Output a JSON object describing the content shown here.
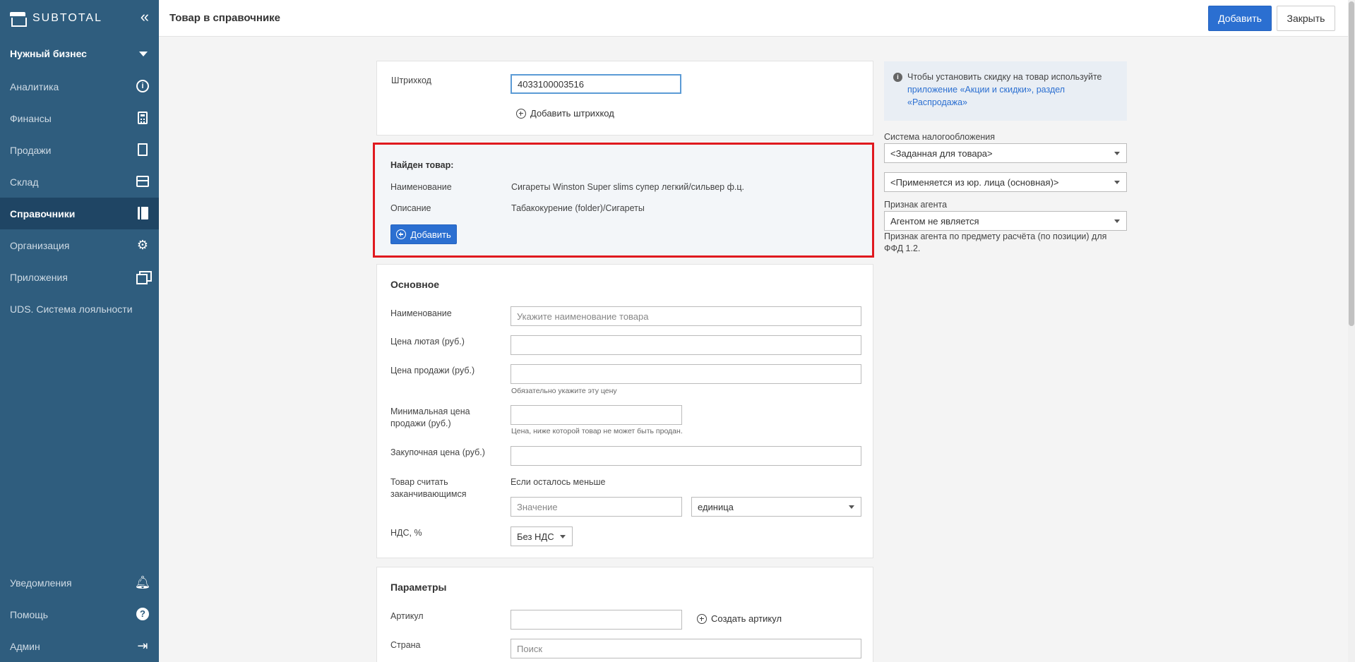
{
  "sidebar": {
    "logo": "SUBTOTAL",
    "business": "Нужный бизнес",
    "items": [
      {
        "label": "Аналитика",
        "icon": "info-icon"
      },
      {
        "label": "Финансы",
        "icon": "calculator-icon"
      },
      {
        "label": "Продажи",
        "icon": "document-icon"
      },
      {
        "label": "Склад",
        "icon": "box-icon"
      },
      {
        "label": "Справочники",
        "icon": "book-icon",
        "active": true
      },
      {
        "label": "Организация",
        "icon": "gear-icon"
      },
      {
        "label": "Приложения",
        "icon": "windows-icon"
      },
      {
        "label": "UDS. Система лояльности"
      }
    ],
    "bottom": [
      {
        "label": "Уведомления",
        "icon": "bell-icon"
      },
      {
        "label": "Помощь",
        "icon": "help-icon"
      },
      {
        "label": "Админ",
        "icon": "logout-icon"
      }
    ]
  },
  "header": {
    "title": "Товар в справочнике",
    "add_label": "Добавить",
    "close_label": "Закрыть"
  },
  "barcode": {
    "label": "Штрихкод",
    "value": "4033100003516",
    "add_label": "Добавить штрихкод"
  },
  "found": {
    "title": "Найден товар:",
    "name_label": "Наименование",
    "name_value": "Сигареты Winston Super slims супер легкий/сильвер ф.ц.",
    "desc_label": "Описание",
    "desc_value": "Табакокурение (folder)/Сигареты",
    "add_label": "Добавить"
  },
  "main": {
    "title": "Основное",
    "name_label": "Наименование",
    "name_placeholder": "Укажите наименование товара",
    "price_lyut_label": "Цена лютая (руб.)",
    "price_sale_label": "Цена продажи (руб.)",
    "price_sale_hint": "Обязательно укажите эту цену",
    "min_price_label_1": "Минимальная цена",
    "min_price_label_2": "продажи (руб.)",
    "min_price_hint": "Цена, ниже которой товар не может быть продан.",
    "purchase_label": "Закупочная цена (руб.)",
    "ending_label_1": "Товар считать",
    "ending_label_2": "заканчивающимся",
    "ending_text": "Если осталось меньше",
    "ending_placeholder": "Значение",
    "unit_value": "единица",
    "vat_label": "НДС, %",
    "vat_value": "Без НДС"
  },
  "params": {
    "title": "Параметры",
    "article_label": "Артикул",
    "create_article_label": "Создать артикул",
    "country_label": "Страна",
    "country_placeholder": "Поиск"
  },
  "right": {
    "info_text": "Чтобы установить скидку на товар используйте",
    "info_link": "приложение «Акции и скидки», раздел «Распродажа»",
    "tax_label": "Система налогообложения",
    "tax_value": "<Заданная для товара>",
    "legal_value": "<Применяется из юр. лица (основная)>",
    "agent_label": "Признак агента",
    "agent_value": "Агентом не является",
    "agent_hint": "Признак агента по предмету расчёта (по позиции) для ФФД 1.2."
  }
}
